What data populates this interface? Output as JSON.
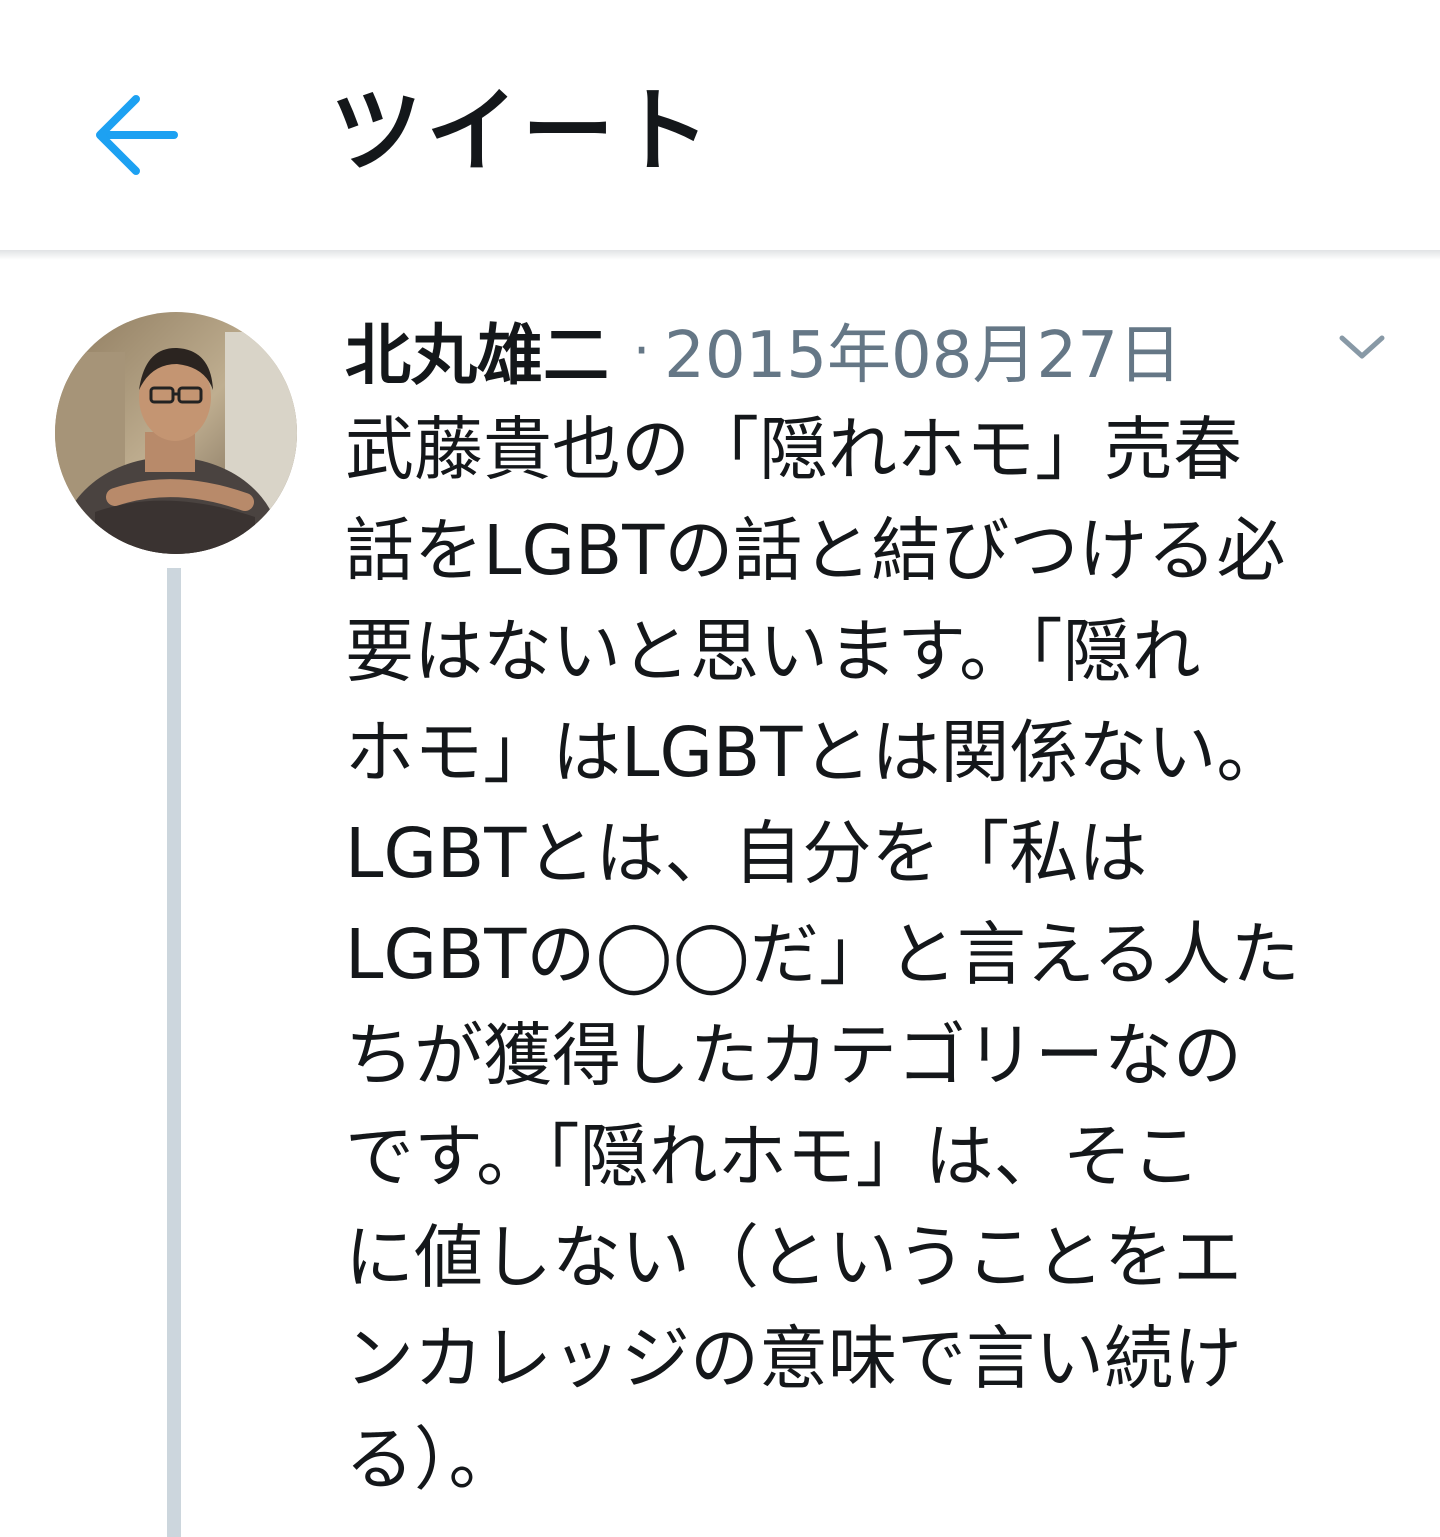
{
  "header": {
    "title": "ツイート",
    "back_icon": "arrow-left-icon",
    "accent_color": "#1da1f2"
  },
  "tweet": {
    "author": "北丸雄二",
    "separator": "·",
    "timestamp": "2015年08月27日",
    "more_icon": "chevron-down-icon",
    "text_lines": [
      "武藤貴也の「隠れホモ」売春",
      "話をLGBTの話と結びつける必",
      "要はないと思います。「隠れ",
      "ホモ」はLGBTとは関係ない。",
      "LGBTとは、自分を「私は",
      "LGBTの◯◯だ」と言える人た",
      "ちが獲得したカテゴリーなの",
      "です。「隠れホモ」は、そこ",
      "に値しない（ということをエ",
      "ンカレッジの意味で言い続け",
      "る）。"
    ]
  }
}
